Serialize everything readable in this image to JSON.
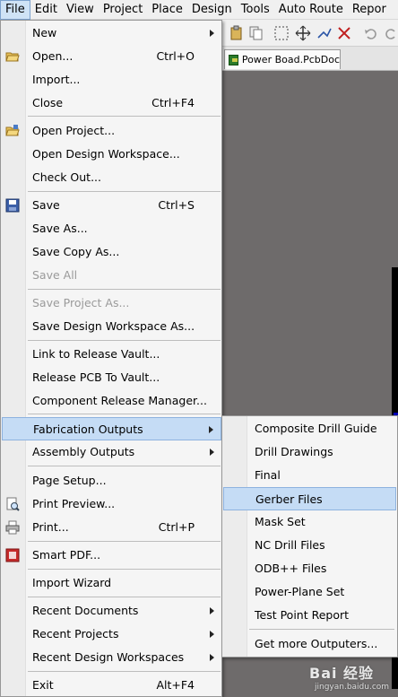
{
  "menubar": {
    "items": [
      "File",
      "Edit",
      "View",
      "Project",
      "Place",
      "Design",
      "Tools",
      "Auto Route",
      "Repor"
    ]
  },
  "tab": {
    "label": "Power Boad.PcbDoc"
  },
  "file_menu": {
    "items": [
      {
        "label": "New"
      },
      {
        "label": "Open...",
        "shortcut": "Ctrl+O"
      },
      {
        "label": "Import..."
      },
      {
        "label": "Close",
        "shortcut": "Ctrl+F4"
      },
      {
        "label": "Open Project..."
      },
      {
        "label": "Open Design Workspace..."
      },
      {
        "label": "Check Out..."
      },
      {
        "label": "Save",
        "shortcut": "Ctrl+S"
      },
      {
        "label": "Save As..."
      },
      {
        "label": "Save Copy As..."
      },
      {
        "label": "Save All"
      },
      {
        "label": "Save Project As..."
      },
      {
        "label": "Save Design Workspace As..."
      },
      {
        "label": "Link to Release Vault..."
      },
      {
        "label": "Release PCB To Vault..."
      },
      {
        "label": "Component Release Manager..."
      },
      {
        "label": "Fabrication Outputs"
      },
      {
        "label": "Assembly Outputs"
      },
      {
        "label": "Page Setup..."
      },
      {
        "label": "Print Preview..."
      },
      {
        "label": "Print...",
        "shortcut": "Ctrl+P"
      },
      {
        "label": "Smart PDF..."
      },
      {
        "label": "Import Wizard"
      },
      {
        "label": "Recent Documents"
      },
      {
        "label": "Recent Projects"
      },
      {
        "label": "Recent Design Workspaces"
      },
      {
        "label": "Exit",
        "shortcut": "Alt+F4"
      }
    ]
  },
  "fabrication_submenu": {
    "items": [
      {
        "label": "Composite Drill Guide"
      },
      {
        "label": "Drill Drawings"
      },
      {
        "label": "Final"
      },
      {
        "label": "Gerber Files"
      },
      {
        "label": "Mask Set"
      },
      {
        "label": "NC Drill Files"
      },
      {
        "label": "ODB++ Files"
      },
      {
        "label": "Power-Plane Set"
      },
      {
        "label": "Test Point Report"
      },
      {
        "label": "Get more Outputers..."
      }
    ]
  },
  "colors": {
    "highlight": "#c5dcf5",
    "workspace": "#6e6b6b",
    "board_blue": "#0000b4",
    "board_red": "#b40000"
  },
  "icons": [
    "open-folder-icon",
    "open-project-icon",
    "save-disk-icon",
    "print-preview-icon",
    "printer-icon",
    "smart-pdf-icon",
    "pcb-document-icon"
  ],
  "watermark": {
    "logo": "Bai 经验",
    "site": "jingyan.baidu.com"
  }
}
